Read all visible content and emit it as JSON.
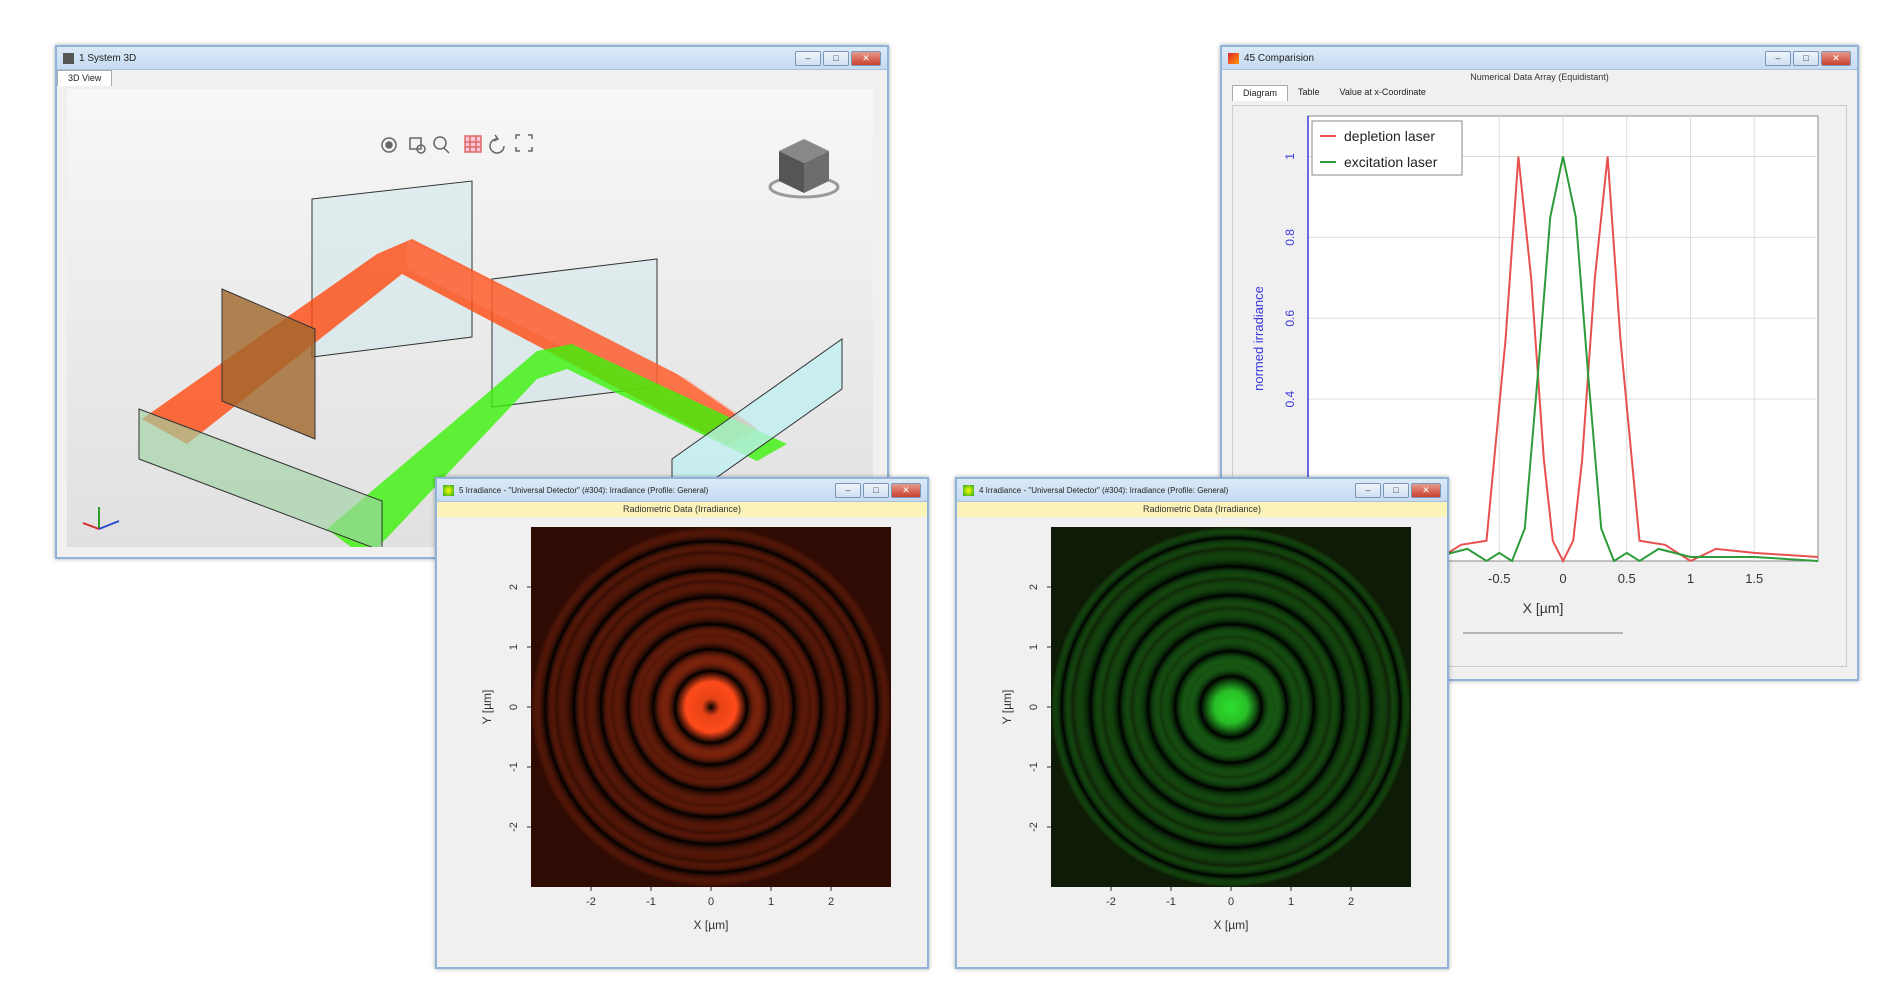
{
  "win3d": {
    "title": "1 System 3D",
    "tab": "3D View",
    "toolbar_icons": [
      "target-icon",
      "zoom-window-icon",
      "zoom-icon",
      "grid-icon",
      "rotate-icon",
      "fit-icon"
    ]
  },
  "comparison": {
    "title": "45 Comparision",
    "subtitle": "Numerical Data Array (Equidistant)",
    "tabs": [
      "Diagram",
      "Table",
      "Value at x-Coordinate"
    ],
    "colors": {
      "depletion": "#e85050",
      "excitation": "#2e9b3a",
      "axis": "#3a3adb"
    }
  },
  "irr5": {
    "title": "5 Irradiance - \"Universal Detector\" (#304): Irradiance (Profile: General)",
    "subtitle": "Radiometric Data (Irradiance)",
    "xlabel": "X [µm]",
    "ylabel": "Y [µm]",
    "color": "#ff4a1a"
  },
  "irr4": {
    "title": "4 Irradiance - \"Universal Detector\" (#304): Irradiance (Profile: General)",
    "subtitle": "Radiometric Data (Irradiance)",
    "xlabel": "X [µm]",
    "ylabel": "Y [µm]",
    "color": "#2ee02e"
  },
  "chart_data": [
    {
      "type": "line",
      "ylabel": "normed irradiance",
      "xlabel": "X [µm]",
      "xlim": [
        -2,
        2
      ],
      "ylim": [
        0,
        1.1
      ],
      "x_ticks": [
        "-0.5",
        "0",
        "0.5",
        "1",
        "1.5"
      ],
      "y_ticks": [
        "0.4",
        "0.6",
        "0.8",
        "1"
      ],
      "legend": "top-left",
      "series": [
        {
          "name": "depletion laser",
          "x": [
            -2,
            -1.5,
            -1.2,
            -1.0,
            -0.8,
            -0.6,
            -0.45,
            -0.35,
            -0.25,
            -0.15,
            -0.08,
            0,
            0.08,
            0.15,
            0.25,
            0.35,
            0.45,
            0.6,
            0.8,
            1.0,
            1.2,
            1.5,
            2
          ],
          "y": [
            0.01,
            0.02,
            0.03,
            0.0,
            0.04,
            0.05,
            0.55,
            1.0,
            0.7,
            0.25,
            0.05,
            0,
            0.05,
            0.25,
            0.7,
            1.0,
            0.55,
            0.05,
            0.04,
            0.0,
            0.03,
            0.02,
            0.01
          ]
        },
        {
          "name": "excitation laser",
          "x": [
            -2,
            -1.5,
            -1.0,
            -0.75,
            -0.6,
            -0.5,
            -0.4,
            -0.3,
            -0.2,
            -0.1,
            0,
            0.1,
            0.2,
            0.3,
            0.4,
            0.5,
            0.6,
            0.75,
            1.0,
            1.5,
            2
          ],
          "y": [
            0.0,
            0.01,
            0.01,
            0.03,
            0.0,
            0.02,
            0.0,
            0.08,
            0.45,
            0.85,
            1.0,
            0.85,
            0.45,
            0.08,
            0.0,
            0.02,
            0.0,
            0.03,
            0.01,
            0.01,
            0.0
          ]
        }
      ]
    },
    {
      "type": "heatmap",
      "title": "5 Irradiance",
      "xlabel": "X [µm]",
      "ylabel": "Y [µm]",
      "xlim": [
        -3,
        3
      ],
      "ylim": [
        -3,
        3
      ],
      "x_ticks": [
        "-2",
        "-1",
        "0",
        "1",
        "2"
      ],
      "y_ticks": [
        "2",
        "1",
        "0",
        "-1",
        "-2"
      ],
      "pattern": "donut with concentric rings"
    },
    {
      "type": "heatmap",
      "title": "4 Irradiance",
      "xlabel": "X [µm]",
      "ylabel": "Y [µm]",
      "xlim": [
        -3,
        3
      ],
      "ylim": [
        -3,
        3
      ],
      "x_ticks": [
        "-2",
        "-1",
        "0",
        "1",
        "2"
      ],
      "y_ticks": [
        "2",
        "1",
        "0",
        "-1",
        "-2"
      ],
      "pattern": "airy disk with concentric rings"
    }
  ]
}
